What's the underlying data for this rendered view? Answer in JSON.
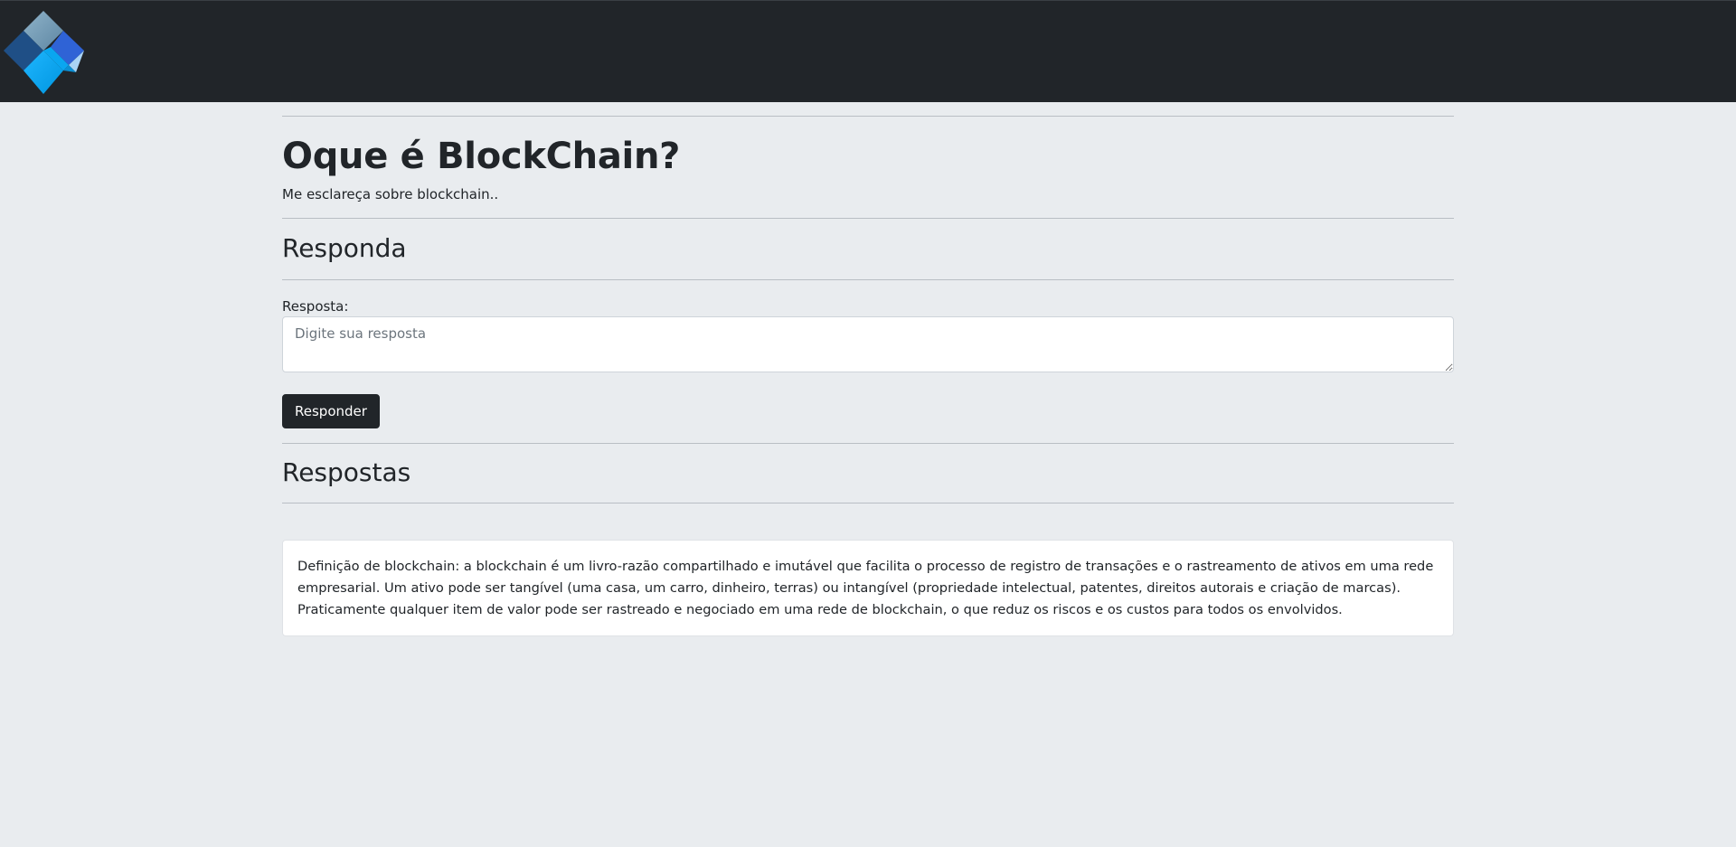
{
  "navbar": {
    "logo_icon": "blockchain-logo-icon",
    "colors": {
      "background": "#212529"
    }
  },
  "question": {
    "title": "Oque é BlockChain?",
    "description": "Me esclareça sobre blockchain.."
  },
  "answer_form": {
    "heading": "Responda",
    "label": "Resposta:",
    "placeholder": "Digite sua resposta",
    "value": "",
    "submit_label": "Responder"
  },
  "answers": {
    "heading": "Respostas",
    "items": [
      {
        "text": "Definição de blockchain: a blockchain é um livro-razão compartilhado e imutável que facilita o processo de registro de transações e o rastreamento de ativos em uma rede empresarial. Um ativo pode ser tangível (uma casa, um carro, dinheiro, terras) ou intangível (propriedade intelectual, patentes, direitos autorais e criação de marcas). Praticamente qualquer item de valor pode ser rastreado e negociado em uma rede de blockchain, o que reduz os riscos e os custos para todos os envolvidos."
      }
    ]
  },
  "theme": {
    "page_background": "#e9ecef",
    "button_background": "#212529",
    "text_color": "#212529"
  }
}
